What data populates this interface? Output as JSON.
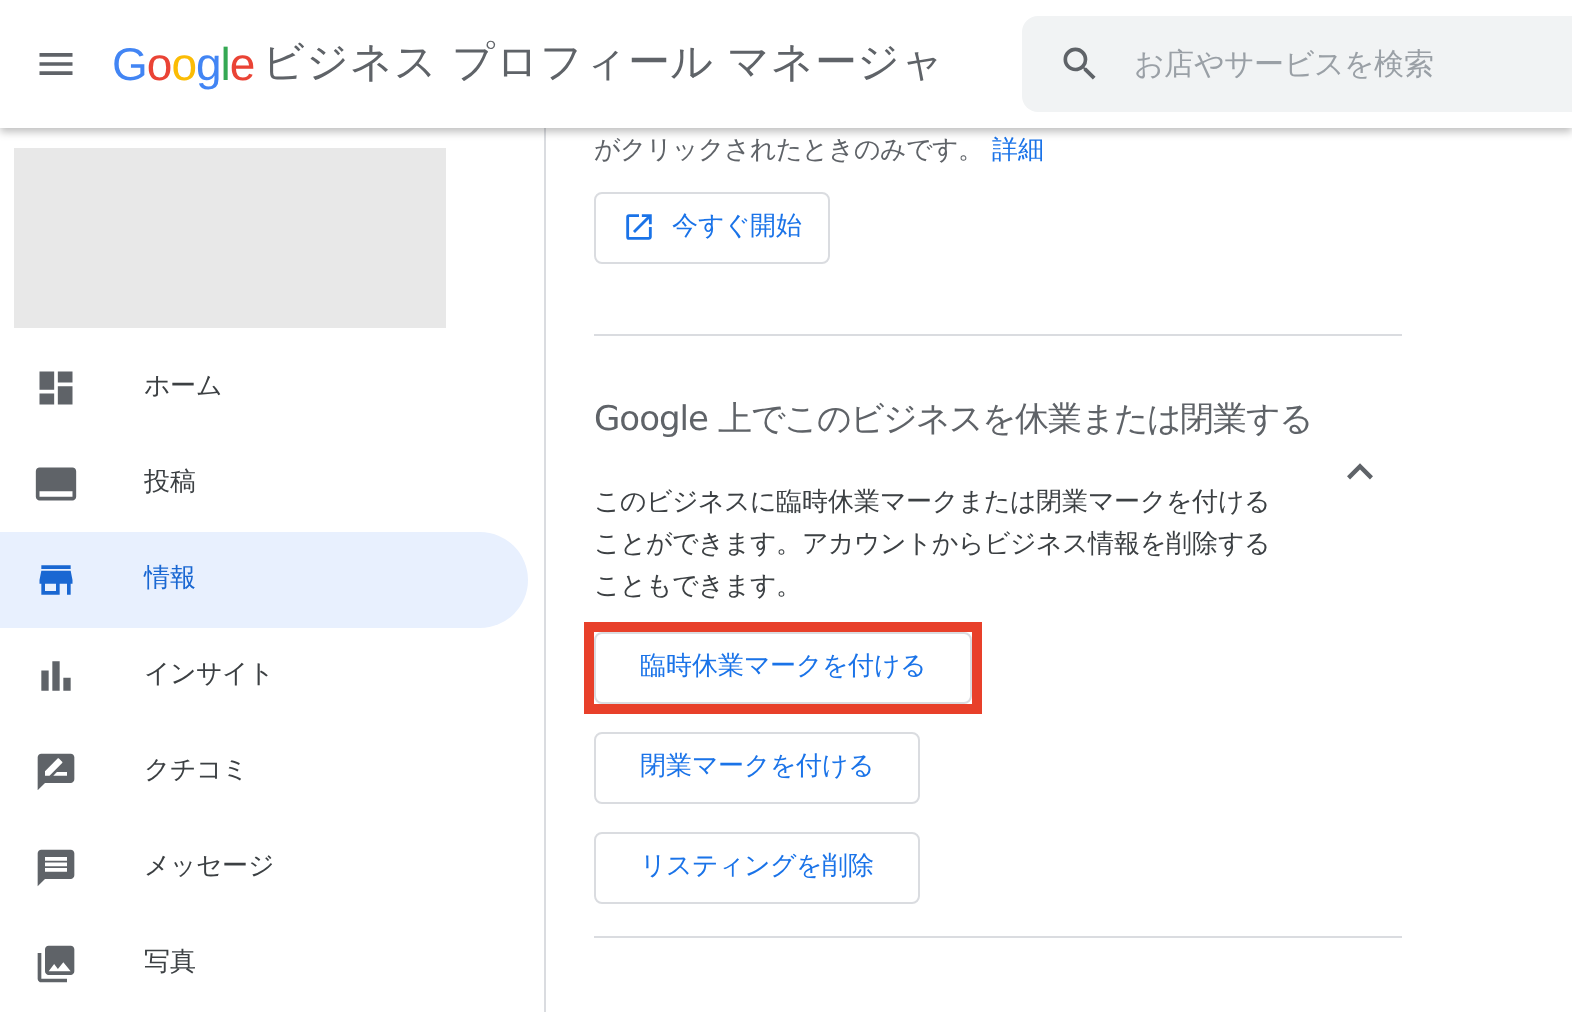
{
  "header": {
    "logo": "Google",
    "title": "ビジネス プロフィール マネージャ",
    "search": {
      "placeholder": "お店やサービスを検索"
    }
  },
  "sidebar": {
    "items": [
      {
        "label": "ホーム",
        "selected": false
      },
      {
        "label": "投稿",
        "selected": false
      },
      {
        "label": "情報",
        "selected": true
      },
      {
        "label": "インサイト",
        "selected": false
      },
      {
        "label": "クチコミ",
        "selected": false
      },
      {
        "label": "メッセージ",
        "selected": false
      },
      {
        "label": "写真",
        "selected": false
      }
    ]
  },
  "content": {
    "top_text": "がクリックされたときのみです。",
    "top_link": "詳細",
    "start_button": "今すぐ開始",
    "section": {
      "title": "Google 上でこのビジネスを休業または閉業する",
      "expanded": true,
      "description": "このビジネスに臨時休業マークまたは閉業マークを付けることができます。アカウントからビジネス情報を削除することもできます。",
      "buttons": [
        {
          "label": "臨時休業マークを付ける",
          "highlighted": true
        },
        {
          "label": "閉業マークを付ける",
          "highlighted": false
        },
        {
          "label": "リスティングを削除",
          "highlighted": false
        }
      ]
    }
  }
}
